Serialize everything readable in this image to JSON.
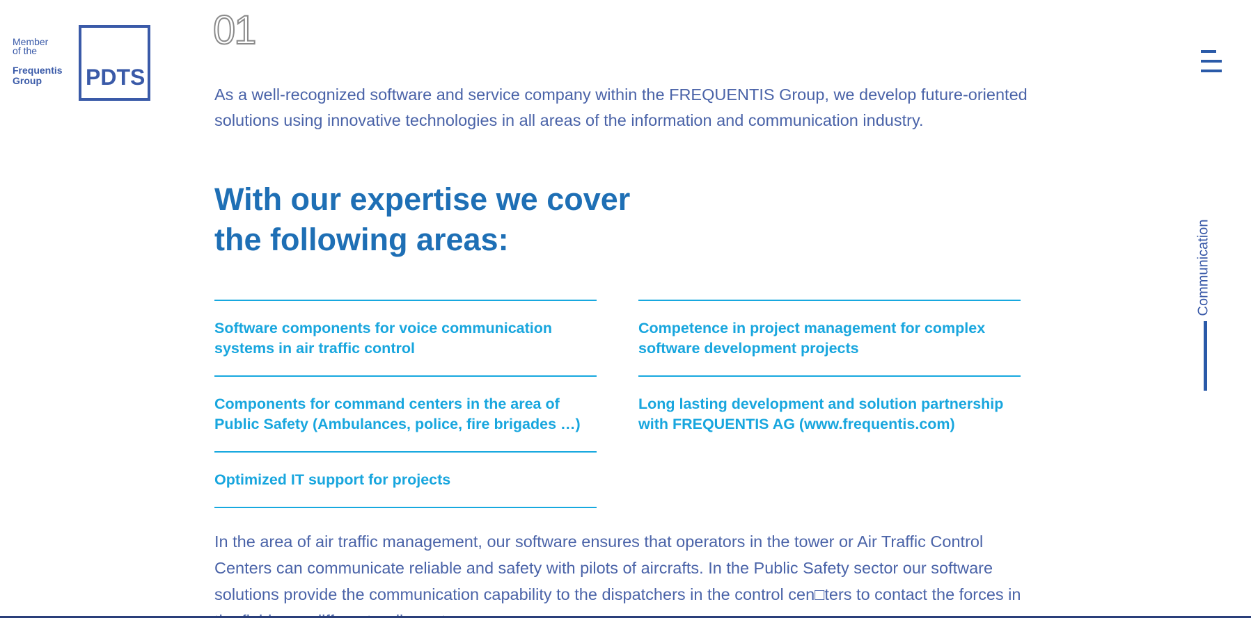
{
  "logo": {
    "member_line1": "Member",
    "member_line2": "of the",
    "group_line1": "Frequentis",
    "group_line2": "Group",
    "box_text": "PDTS"
  },
  "section": {
    "number": "01",
    "intro": "As a well-recognized software and service company within the FREQUENTIS Group, we develop future-oriented solutions using innovative technologies in all areas of the information and communication industry.",
    "heading_line1": "With our expertise we cover",
    "heading_line2": "the following areas:"
  },
  "areas": {
    "left": [
      "Software components for voice communication systems in air traffic control",
      "Components for command centers in the area of Public Safety (Ambulances, police, fire brigades …)",
      "Optimized IT support for projects"
    ],
    "right": [
      "Competence in project management for complex software development projects",
      "Long lasting development and solution partnership with FREQUENTIS AG (www.frequentis.com)"
    ]
  },
  "body_text": "In the area of air traffic management, our software ensures that operators in the tower or Air Traffic Control Centers can communicate reliable and safety with pilots of aircrafts. In the Public Safety sector our software solutions provide the communication capability to the dispatchers in the control cen□ters to contact the forces in the field over different radio systems.",
  "side_nav": {
    "label": "Communication"
  },
  "menu": {
    "icon": "hamburger-menu-icon"
  },
  "colors": {
    "brand_blue": "#3a5aa8",
    "heading_blue": "#1e6fb5",
    "accent_cyan": "#18a6de"
  }
}
